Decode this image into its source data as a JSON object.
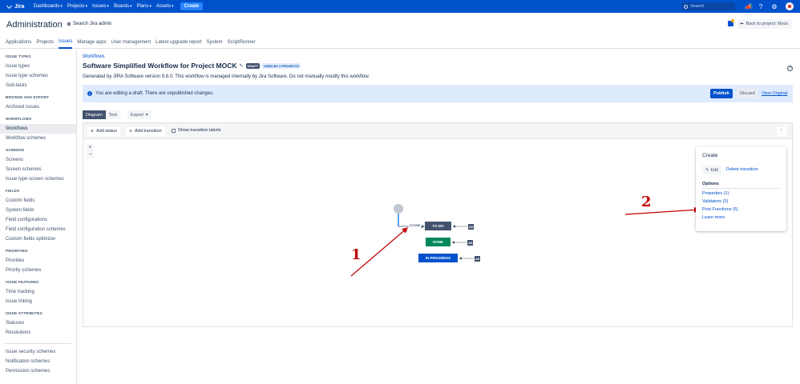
{
  "topnav": {
    "logo": "Jira",
    "menu": [
      {
        "label": "Dashboards"
      },
      {
        "label": "Projects"
      },
      {
        "label": "Issues"
      },
      {
        "label": "Boards"
      },
      {
        "label": "Plans"
      },
      {
        "label": "Assets"
      }
    ],
    "create_label": "Create",
    "search_placeholder": "Search"
  },
  "header": {
    "title": "Administration",
    "admin_search": "Search Jira admin",
    "back_button": "Back to project: Mock"
  },
  "admin_tabs": [
    {
      "label": "Applications",
      "active": false
    },
    {
      "label": "Projects",
      "active": false
    },
    {
      "label": "Issues",
      "active": true
    },
    {
      "label": "Manage apps",
      "active": false
    },
    {
      "label": "User management",
      "active": false
    },
    {
      "label": "Latest upgrade report",
      "active": false
    },
    {
      "label": "System",
      "active": false
    },
    {
      "label": "ScriptRunner",
      "active": false
    }
  ],
  "sidebar": {
    "sections": [
      {
        "title": "ISSUE TYPES",
        "links": [
          "Issue types",
          "Issue type schemes",
          "Sub-tasks"
        ]
      },
      {
        "title": "BROWSE AND EXPORT",
        "links": [
          "Archived issues"
        ]
      },
      {
        "title": "WORKFLOWS",
        "links": [
          "Workflows",
          "Workflow schemes"
        ]
      },
      {
        "title": "SCREENS",
        "links": [
          "Screens",
          "Screen schemes",
          "Issue type screen schemes"
        ]
      },
      {
        "title": "FIELDS",
        "links": [
          "Custom fields",
          "System fields",
          "Field configurations",
          "Field configuration schemes",
          "Custom fields optimizer"
        ]
      },
      {
        "title": "PRIORITIES",
        "links": [
          "Priorities",
          "Priority schemes"
        ]
      },
      {
        "title": "ISSUE FEATURES",
        "links": [
          "Time tracking",
          "Issue linking"
        ]
      },
      {
        "title": "ISSUE ATTRIBUTES",
        "links": [
          "Statuses",
          "Resolutions"
        ]
      },
      {
        "title": "",
        "links": [
          "Issue security schemes",
          "Notification schemes",
          "Permission schemes"
        ]
      }
    ],
    "active_link": "Workflows"
  },
  "main": {
    "breadcrumb": "Workflows",
    "title": "Software Simplified Workflow for Project MOCK",
    "draft_lozenge": "DRAFT",
    "used_by_lozenge": "USED BY 2 PROJECTS",
    "description": "Generated by JIRA Software version 9.8.0. This workflow is managed internally by Jira Software. Do not manually modify this workflow.",
    "banner": {
      "message": "You are editing a draft. There are unpublished changes.",
      "publish": "Publish",
      "discard": "Discard",
      "view_original": "View Original"
    },
    "view_toggle": [
      "Diagram",
      "Text"
    ],
    "export_label": "Export",
    "toolbar": {
      "add_status": "Add status",
      "add_transition": "Add transition",
      "show_labels": "Show transition labels"
    },
    "zoom_in": "+",
    "zoom_out": "−",
    "diagram": {
      "create_label": "Create",
      "statuses": [
        "TO DO",
        "DONE",
        "IN PROGRESS"
      ],
      "all_label": "All"
    },
    "panel": {
      "title": "Create",
      "edit": "Edit",
      "delete": "Delete transition",
      "options_title": "Options",
      "options": [
        "Properties (1)",
        "Validators (3)",
        "Post Functions (5)",
        "Learn more"
      ]
    },
    "annotations": [
      "1",
      "2"
    ]
  },
  "colors": {
    "nav": "#0052cc",
    "todo": "#42526e",
    "done": "#00875a",
    "in_progress": "#0052cc",
    "annotation": "#c00000"
  }
}
